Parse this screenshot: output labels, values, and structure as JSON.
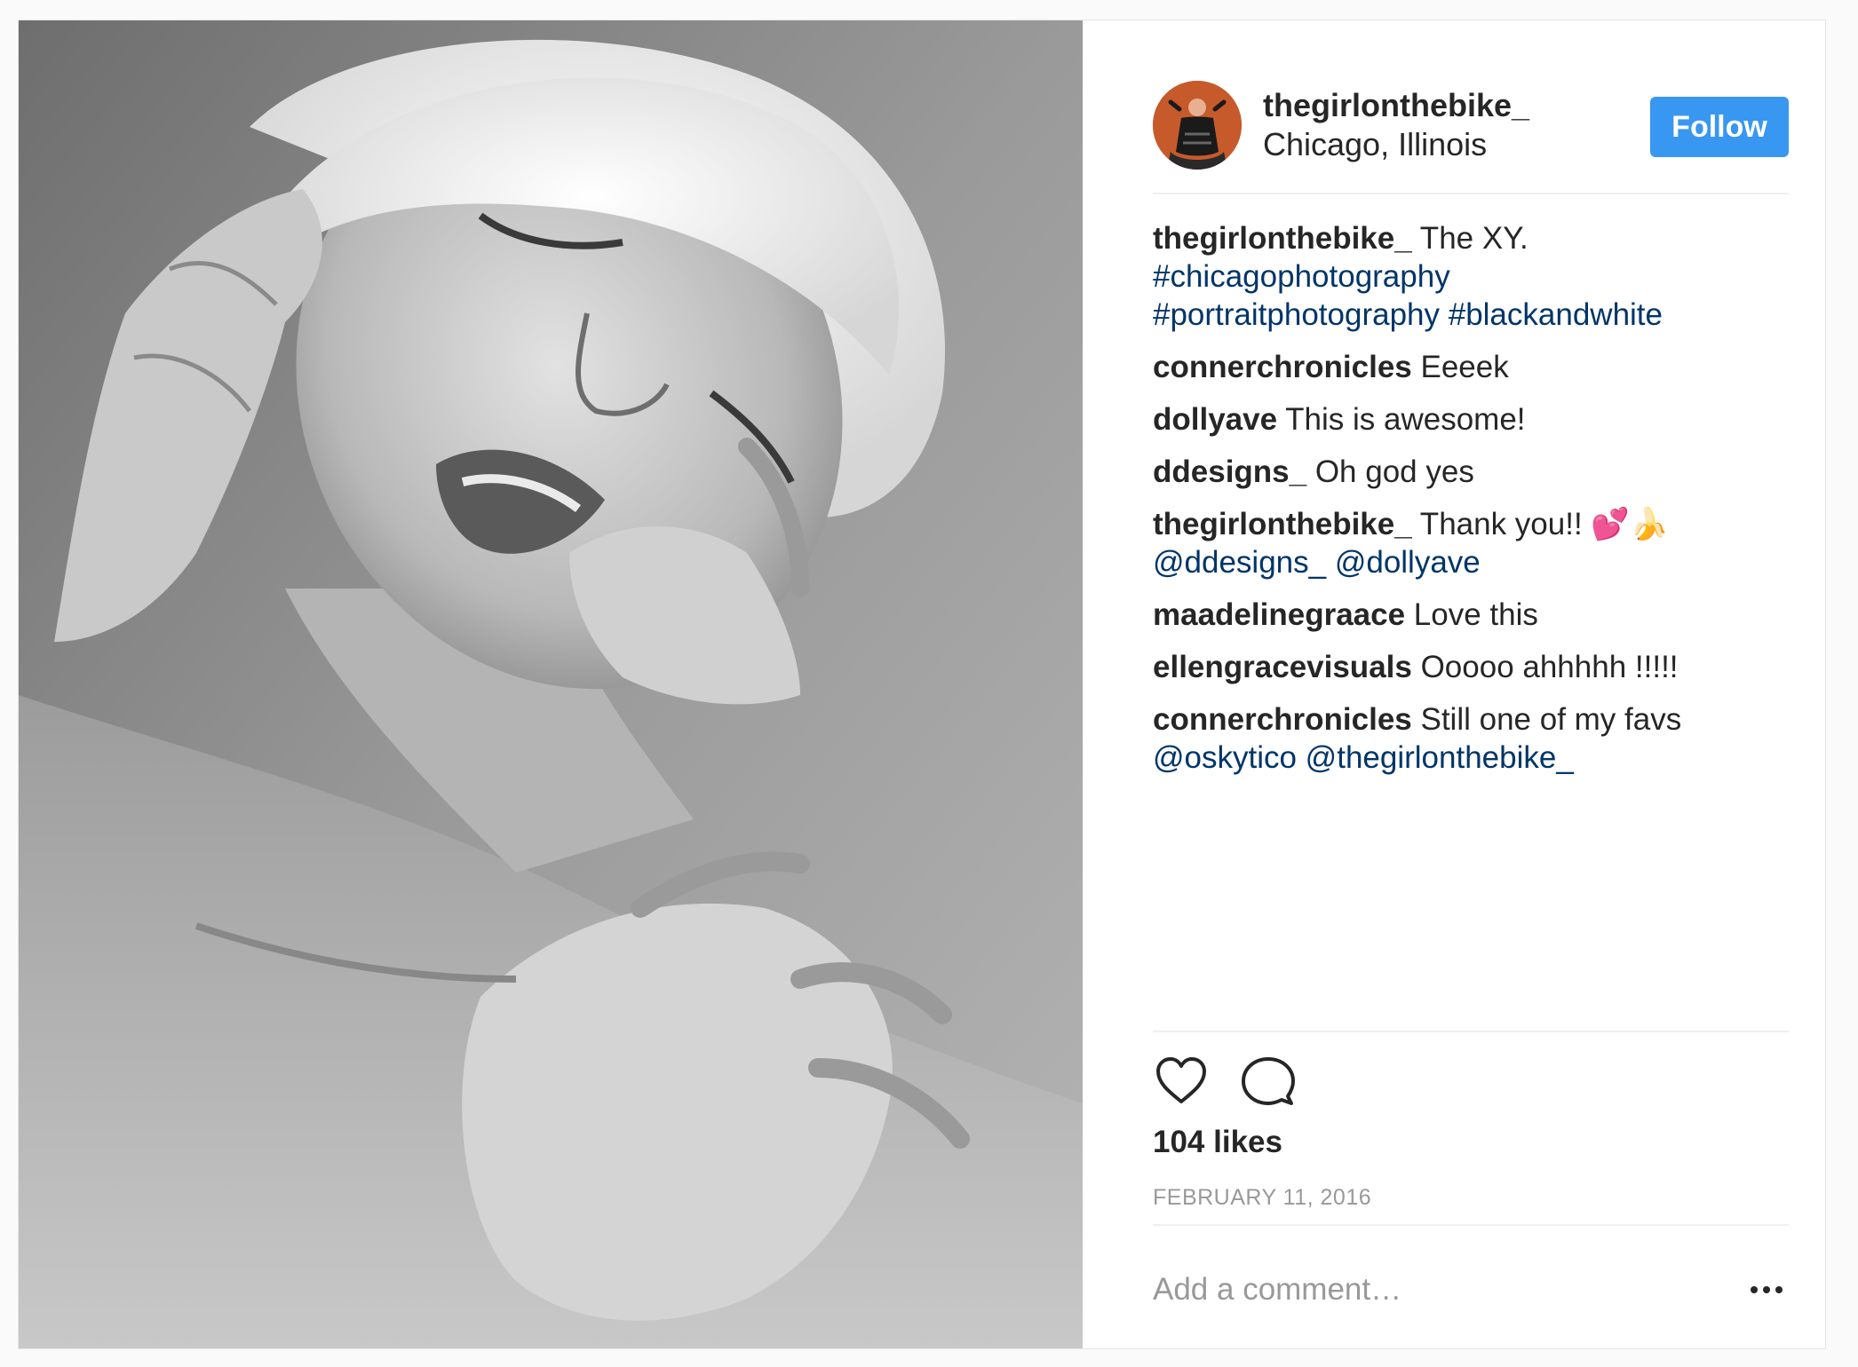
{
  "post": {
    "username": "thegirlonthebike_",
    "location": "Chicago, Illinois",
    "follow_label": "Follow",
    "likes_text": "104 likes",
    "date_text": "FEBRUARY 11, 2016",
    "comment_placeholder": "Add a comment…",
    "photo_alt": "Black and white portrait photograph",
    "avatar_alt": "thegirlonthebike_ profile picture"
  },
  "comments": [
    {
      "author": "thegirlonthebike_",
      "text": " The XY.",
      "links": [
        "#chicagophotography",
        "#portraitphotography #blackandwhite"
      ]
    },
    {
      "author": "connerchronicles",
      "text": " Eeeek",
      "links": []
    },
    {
      "author": "dollyave",
      "text": " This is awesome!",
      "links": []
    },
    {
      "author": "ddesigns_",
      "text": " Oh god yes",
      "links": []
    },
    {
      "author": "thegirlonthebike_",
      "text": " Thank you!! 💕🍌",
      "links": [
        "@ddesigns_ @dollyave"
      ]
    },
    {
      "author": "maadelinegraace",
      "text": " Love this",
      "links": []
    },
    {
      "author": "ellengracevisuals",
      "text": " Ooooo ahhhhh !!!!!",
      "links": []
    },
    {
      "author": "connerchronicles",
      "text": " Still one of my favs",
      "links": [
        "@oskytico @thegirlonthebike_"
      ]
    }
  ],
  "colors": {
    "follow_button": "#3897f0",
    "link": "#003569",
    "text": "#262626",
    "muted": "#999999"
  },
  "icons": {
    "like": "heart-icon",
    "comment": "comment-bubble-icon",
    "more": "more-options-icon"
  }
}
